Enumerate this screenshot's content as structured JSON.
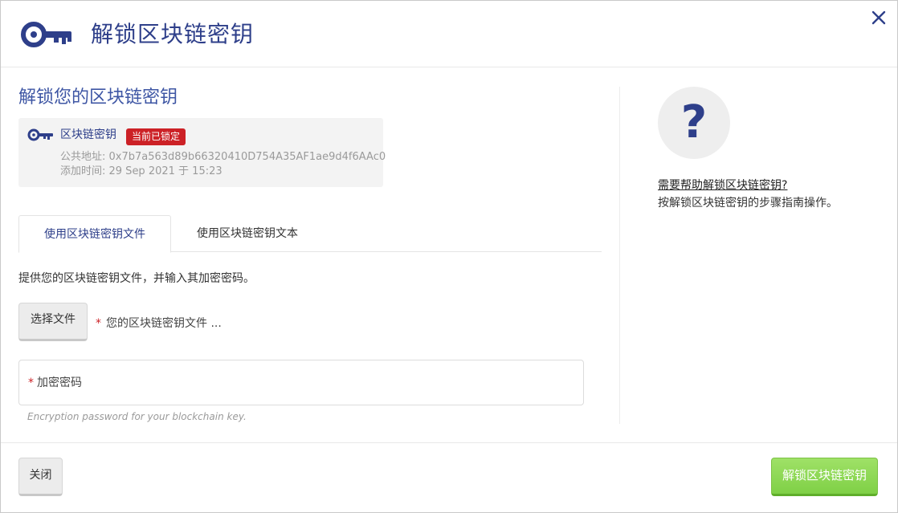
{
  "header": {
    "title": "解锁区块链密钥",
    "icon": "key-icon",
    "close_icon": "close-icon",
    "accent_color": "#2e3f8a"
  },
  "main": {
    "section_title": "解锁您的区块链密钥",
    "key_card": {
      "name": "区块链密钥",
      "status_badge": "当前已锁定",
      "status_color": "#cc2126",
      "address": "公共地址: 0x7b7a563d89b66320410D754A35AF1ae9d4f6AAc0",
      "added": "添加时间:  29 Sep 2021 于 15:23"
    },
    "tabs": [
      {
        "label": "使用区块链密钥文件",
        "active": true
      },
      {
        "label": "使用区块链密钥文本",
        "active": false
      }
    ],
    "instruction": "提供您的区块链密钥文件，并输入其加密密码。",
    "file": {
      "button_label": "选择文件",
      "required_mark": "*",
      "placeholder": "您的区块链密钥文件 ..."
    },
    "password": {
      "required_mark": "*",
      "placeholder": "加密密码",
      "value": "",
      "hint": "Encryption password for your blockchain key."
    }
  },
  "help": {
    "icon": "help-icon",
    "link": "需要帮助解锁区块链密钥?",
    "description": "按解锁区块链密钥的步骤指南操作。"
  },
  "footer": {
    "close_label": "关闭",
    "unlock_label": "解锁区块链密钥",
    "unlock_color": "#8ad455"
  }
}
